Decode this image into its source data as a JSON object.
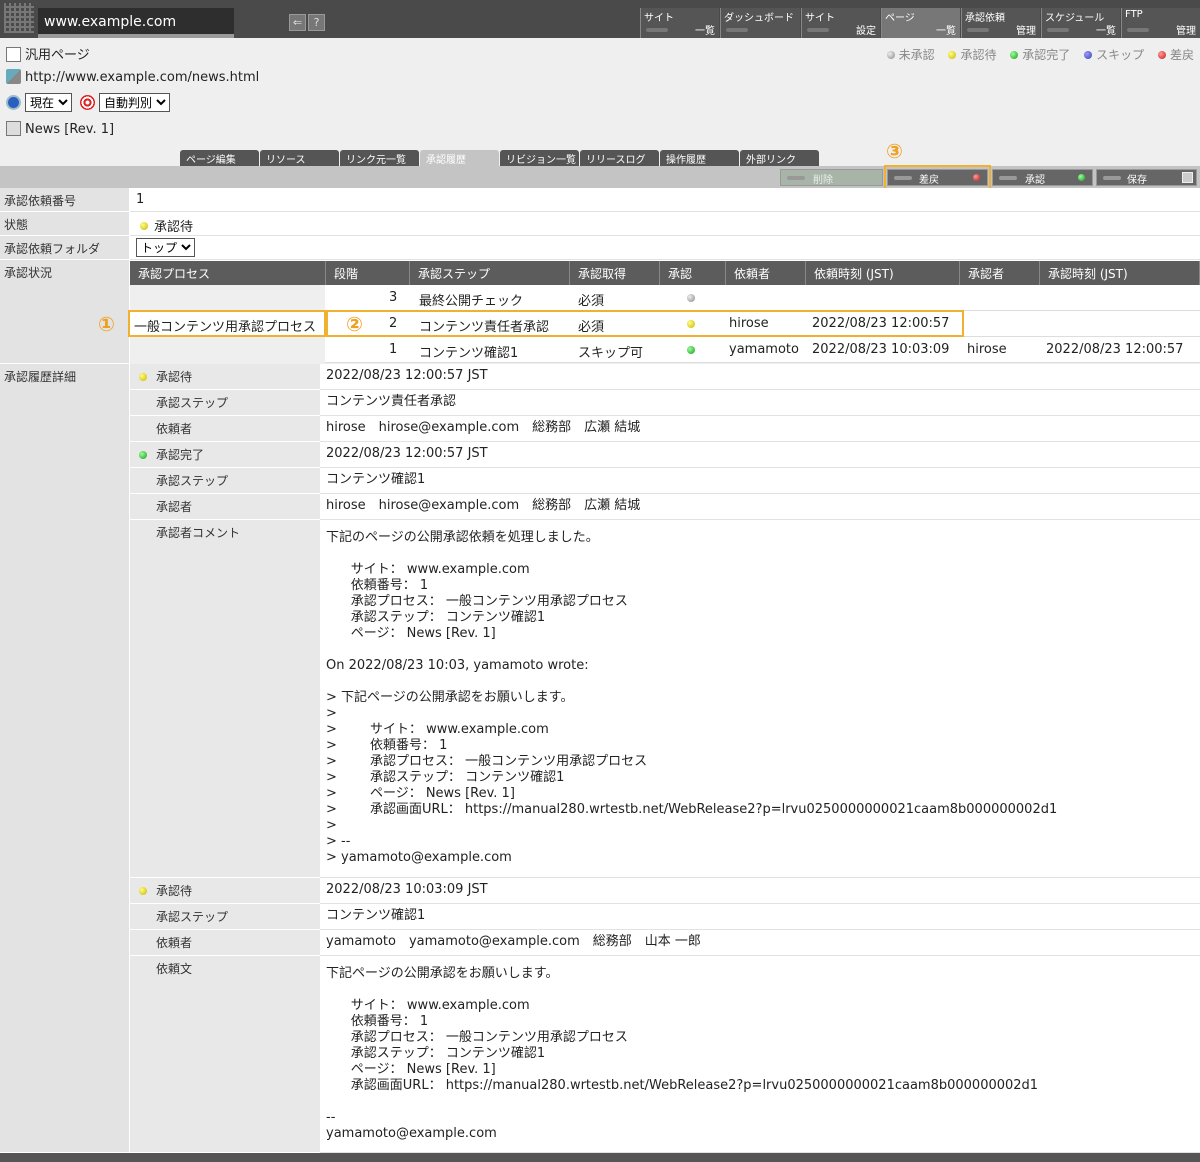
{
  "header": {
    "site": "www.example.com",
    "menus": [
      {
        "l1": "サイト",
        "l2": "一覧"
      },
      {
        "l1": "ダッシュボード",
        "l2": ""
      },
      {
        "l1": "サイト",
        "l2": "設定"
      },
      {
        "l1": "ページ",
        "l2": "一覧"
      },
      {
        "l1": "承認依頼",
        "l2": "管理"
      },
      {
        "l1": "スケジュール",
        "l2": "一覧"
      },
      {
        "l1": "FTP",
        "l2": "管理"
      }
    ],
    "help_label": "?"
  },
  "info": {
    "page_type": "汎用ページ",
    "url": "http://www.example.com/news.html",
    "time_select": "現在",
    "mode_select": "自動判別",
    "revision": "News [Rev. 1]"
  },
  "legend": [
    {
      "label": "未承認",
      "color": "gray"
    },
    {
      "label": "承認待",
      "color": "yellow"
    },
    {
      "label": "承認完了",
      "color": "green"
    },
    {
      "label": "スキップ",
      "color": "blue"
    },
    {
      "label": "差戻",
      "color": "red"
    }
  ],
  "tabs": [
    "ページ編集",
    "リソース",
    "リンク元一覧",
    "承認履歴",
    "リビジョン一覧",
    "リリースログ",
    "操作履歴",
    "外部リンク"
  ],
  "actions": {
    "delete": "削除",
    "reject": "差戻",
    "approve": "承認",
    "save": "保存"
  },
  "callouts": [
    "①",
    "②",
    "③"
  ],
  "fields": {
    "request_no_label": "承認依頼番号",
    "request_no": "1",
    "state_label": "状態",
    "state": "承認待",
    "folder_label": "承認依頼フォルダ",
    "folder": "トップ",
    "status_label": "承認状況",
    "history_label": "承認履歴詳細"
  },
  "table": {
    "headers": [
      "承認プロセス",
      "段階",
      "承認ステップ",
      "承認取得",
      "承認",
      "依頼者",
      "依頼時刻 (JST)",
      "承認者",
      "承認時刻 (JST)"
    ],
    "process": "一般コンテンツ用承認プロセス",
    "rows": [
      {
        "stage": "3",
        "step": "最終公開チェック",
        "req": "必須",
        "dot": "gray",
        "requester": "",
        "req_time": "",
        "approver": "",
        "app_time": ""
      },
      {
        "stage": "2",
        "step": "コンテンツ責任者承認",
        "req": "必須",
        "dot": "yellow",
        "requester": "hirose",
        "req_time": "2022/08/23 12:00:57",
        "approver": "",
        "app_time": ""
      },
      {
        "stage": "1",
        "step": "コンテンツ確認1",
        "req": "スキップ可",
        "dot": "green",
        "requester": "yamamoto",
        "req_time": "2022/08/23 10:03:09",
        "approver": "hirose",
        "app_time": "2022/08/23 12:00:57"
      }
    ]
  },
  "history": {
    "h1_label": "承認待",
    "h1_time": "2022/08/23 12:00:57 JST",
    "step_label": "承認ステップ",
    "h1_step": "コンテンツ責任者承認",
    "requester_label": "依頼者",
    "h1_requester": "hirose　hirose@example.com　総務部　広瀬 結城",
    "h2_label": "承認完了",
    "h2_time": "2022/08/23 12:00:57 JST",
    "h2_step": "コンテンツ確認1",
    "approver_label": "承認者",
    "h2_approver": "hirose　hirose@example.com　総務部　広瀬 結城",
    "comment_label": "承認者コメント",
    "h2_comment": "下記のページの公開承認依頼を処理しました。\n\n      サイト： www.example.com\n      依頼番号： 1\n      承認プロセス： 一般コンテンツ用承認プロセス\n      承認ステップ： コンテンツ確認1\n      ページ： News [Rev. 1]\n\nOn 2022/08/23 10:03, yamamoto wrote:\n\n> 下記ページの公開承認をお願いします。\n>\n>        サイト： www.example.com\n>        依頼番号： 1\n>        承認プロセス： 一般コンテンツ用承認プロセス\n>        承認ステップ： コンテンツ確認1\n>        ページ： News [Rev. 1]\n>        承認画面URL： https://manual280.wrtestb.net/WebRelease2?p=lrvu0250000000021caam8b000000002d1\n>\n> --\n> yamamoto@example.com",
    "h3_label": "承認待",
    "h3_time": "2022/08/23 10:03:09 JST",
    "h3_step": "コンテンツ確認1",
    "h3_requester": "yamamoto　yamamoto@example.com　総務部　山本 一郎",
    "request_text_label": "依頼文",
    "h3_text": "下記ページの公開承認をお願いします。\n\n      サイト： www.example.com\n      依頼番号： 1\n      承認プロセス： 一般コンテンツ用承認プロセス\n      承認ステップ： コンテンツ確認1\n      ページ： News [Rev. 1]\n      承認画面URL： https://manual280.wrtestb.net/WebRelease2?p=lrvu0250000000021caam8b000000002d1\n\n--\nyamamoto@example.com"
  }
}
